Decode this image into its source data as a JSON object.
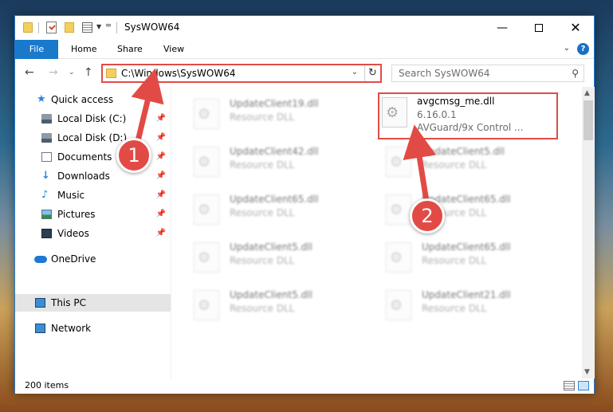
{
  "window": {
    "title": "SysWOW64"
  },
  "ribbon": {
    "tabs": [
      "File",
      "Home",
      "Share",
      "View"
    ]
  },
  "navigation": {
    "address_path": "C:\\Windows\\SysWOW64",
    "search_placeholder": "Search SysWOW64"
  },
  "sidebar": {
    "items": [
      {
        "label": "Quick access",
        "icon": "star-icon"
      },
      {
        "label": "Local Disk (C:)",
        "icon": "disk-icon",
        "pinned": true
      },
      {
        "label": "Local Disk (D:)",
        "icon": "disk-icon",
        "pinned": true
      },
      {
        "label": "Documents",
        "icon": "documents-icon",
        "pinned": true
      },
      {
        "label": "Downloads",
        "icon": "download-icon",
        "pinned": true
      },
      {
        "label": "Music",
        "icon": "music-icon",
        "pinned": true
      },
      {
        "label": "Pictures",
        "icon": "pictures-icon",
        "pinned": true
      },
      {
        "label": "Videos",
        "icon": "videos-icon",
        "pinned": true
      },
      {
        "label": "OneDrive",
        "icon": "cloud-icon"
      },
      {
        "label": "This PC",
        "icon": "pc-icon",
        "selected": true
      },
      {
        "label": "Network",
        "icon": "network-icon"
      }
    ]
  },
  "files": {
    "left_column": [
      {
        "name": "UpdateClient19.dll",
        "type": "Resource DLL"
      },
      {
        "name": "UpdateClient42.dll",
        "type": "Resource DLL"
      },
      {
        "name": "UpdateClient65.dll",
        "type": "Resource DLL"
      },
      {
        "name": "UpdateClient5.dll",
        "type": "Resource DLL"
      },
      {
        "name": "UpdateClient5.dll",
        "type": "Resource DLL"
      }
    ],
    "highlighted": {
      "name": "avgcmsg_me.dll",
      "version": "6.16.0.1",
      "description": "AVGuard/9x Control ..."
    },
    "right_column": [
      {
        "name": "UpdateClient5.dll",
        "type": "Resource DLL"
      },
      {
        "name": "UpdateClient65.dll",
        "type": "Resource DLL"
      },
      {
        "name": "UpdateClient65.dll",
        "type": "Resource DLL"
      },
      {
        "name": "UpdateClient21.dll",
        "type": "Resource DLL"
      }
    ]
  },
  "status": {
    "item_count": "200 items"
  },
  "callouts": {
    "one": "1",
    "two": "2"
  },
  "colors": {
    "accent": "#1979ca",
    "callout": "#e24b45"
  }
}
